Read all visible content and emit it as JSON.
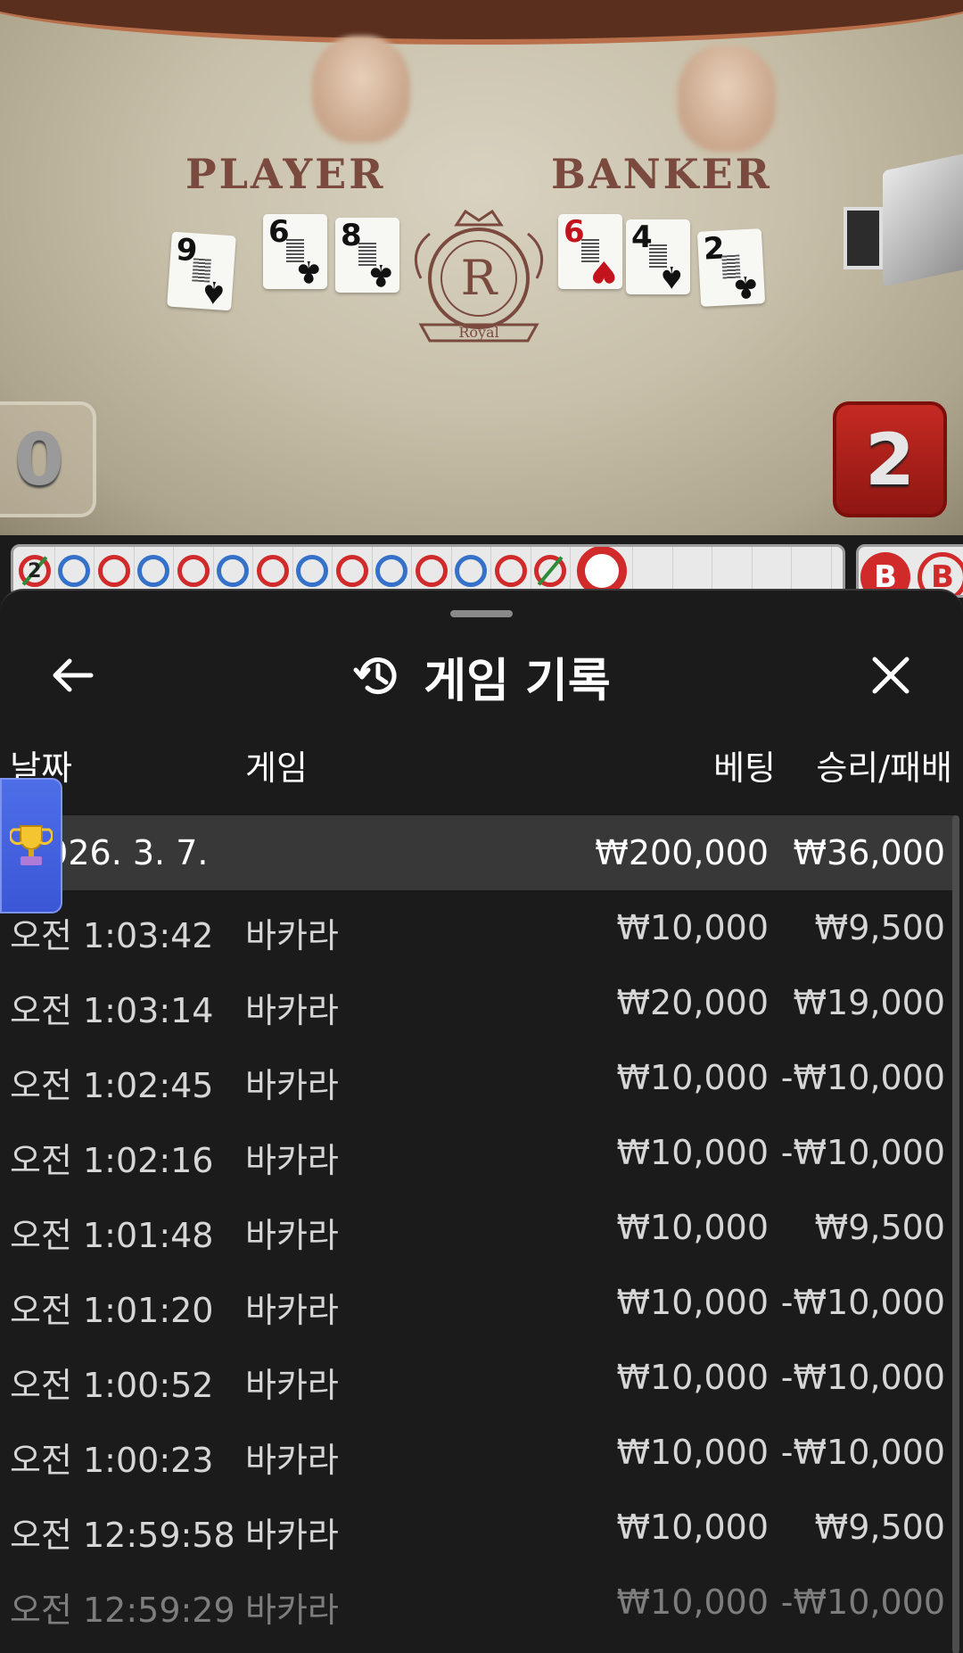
{
  "table": {
    "player_label": "PLAYER",
    "banker_label": "BANKER",
    "logo_letter": "R",
    "logo_text": "Royal",
    "player_score": "0",
    "banker_score": "2",
    "player_cards": [
      {
        "rank": "9",
        "suit": "♠",
        "color": "black"
      },
      {
        "rank": "6",
        "suit": "♣",
        "color": "black"
      },
      {
        "rank": "8",
        "suit": "♣",
        "color": "black"
      }
    ],
    "banker_cards": [
      {
        "rank": "6",
        "suit": "♥",
        "color": "red"
      },
      {
        "rank": "4",
        "suit": "♠",
        "color": "black"
      },
      {
        "rank": "2",
        "suit": "♣",
        "color": "black"
      }
    ]
  },
  "road": {
    "first_cell_number": "2",
    "results": [
      "T",
      "P",
      "B",
      "P",
      "B",
      "P",
      "B",
      "P",
      "B",
      "P",
      "B",
      "P",
      "B",
      "T"
    ],
    "current": "B",
    "side_labels": [
      "B",
      "B"
    ]
  },
  "sheet": {
    "title": "게임 기록",
    "back_icon": "arrow-left-icon",
    "close_icon": "close-icon",
    "history_icon": "history-icon",
    "columns": {
      "date": "날짜",
      "game": "게임",
      "bet": "베팅",
      "result": "승리/패배"
    },
    "summary": {
      "date": "2026. 3. 7.",
      "bet": "₩200,000",
      "result": "₩36,000"
    },
    "rows": [
      {
        "time": "오전 1:03:42",
        "game": "바카라",
        "bet": "₩10,000",
        "result": "₩9,500"
      },
      {
        "time": "오전 1:03:14",
        "game": "바카라",
        "bet": "₩20,000",
        "result": "₩19,000"
      },
      {
        "time": "오전 1:02:45",
        "game": "바카라",
        "bet": "₩10,000",
        "result": "-₩10,000"
      },
      {
        "time": "오전 1:02:16",
        "game": "바카라",
        "bet": "₩10,000",
        "result": "-₩10,000"
      },
      {
        "time": "오전 1:01:48",
        "game": "바카라",
        "bet": "₩10,000",
        "result": "₩9,500"
      },
      {
        "time": "오전 1:01:20",
        "game": "바카라",
        "bet": "₩10,000",
        "result": "-₩10,000"
      },
      {
        "time": "오전 1:00:52",
        "game": "바카라",
        "bet": "₩10,000",
        "result": "-₩10,000"
      },
      {
        "time": "오전 1:00:23",
        "game": "바카라",
        "bet": "₩10,000",
        "result": "-₩10,000"
      },
      {
        "time": "오전 12:59:58",
        "game": "바카라",
        "bet": "₩10,000",
        "result": "₩9,500"
      },
      {
        "time": "오전 12:59:29",
        "game": "바카라",
        "bet": "₩10,000",
        "result": "-₩10,000"
      }
    ],
    "trophy_icon": "trophy-icon"
  }
}
